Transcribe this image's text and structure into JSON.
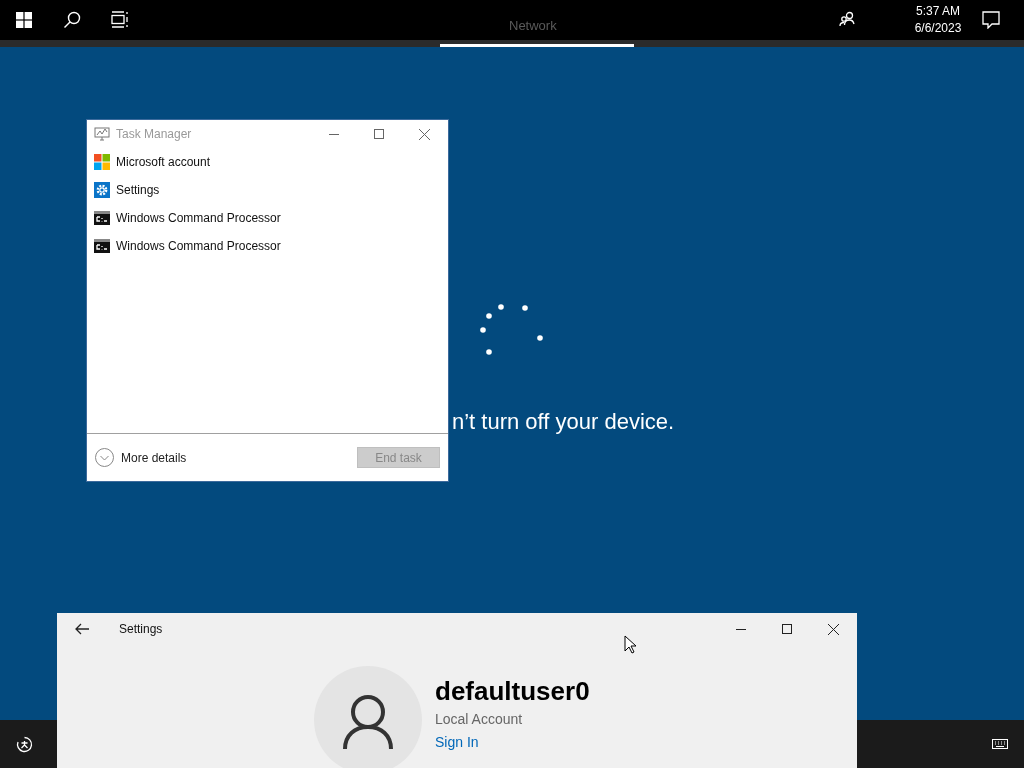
{
  "top_bar": {
    "network_label": "Network",
    "time": "5:37 AM",
    "date": "6/6/2023"
  },
  "status_message": "n’t turn off your device.",
  "task_manager": {
    "title": "Task Manager",
    "apps": [
      {
        "name": "Microsoft account",
        "kind": "account"
      },
      {
        "name": "Settings",
        "kind": "settings"
      },
      {
        "name": "Windows Command Processor",
        "kind": "console"
      },
      {
        "name": "Windows Command Processor",
        "kind": "console"
      }
    ],
    "more_details": "More details",
    "end_task": {
      "label": "End task",
      "disabled": true
    }
  },
  "settings": {
    "title": "Settings",
    "user_name": "defaultuser0",
    "account_type": "Local Account",
    "sign_in": "Sign In"
  }
}
